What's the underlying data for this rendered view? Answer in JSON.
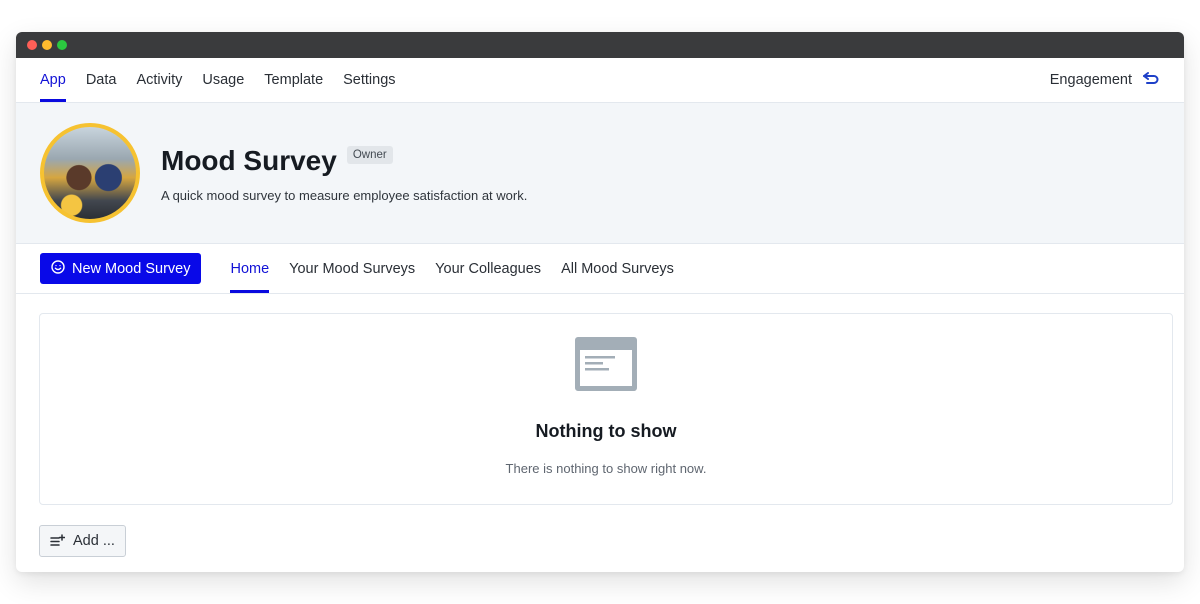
{
  "window": {
    "controls": [
      "close",
      "minimize",
      "maximize"
    ]
  },
  "topnav": {
    "tabs": [
      {
        "label": "App",
        "active": true
      },
      {
        "label": "Data",
        "active": false
      },
      {
        "label": "Activity",
        "active": false
      },
      {
        "label": "Usage",
        "active": false
      },
      {
        "label": "Template",
        "active": false
      },
      {
        "label": "Settings",
        "active": false
      }
    ],
    "right_label": "Engagement",
    "right_icon": "back-arrow-icon"
  },
  "header": {
    "title": "Mood Survey",
    "badge": "Owner",
    "description": "A quick mood survey to measure employee satisfaction at work.",
    "avatar_alt": "Two coworkers smiling at a computer in an office",
    "accent_color": "#f6c231"
  },
  "subnav": {
    "primary_button": {
      "label": "New Mood Survey",
      "icon": "smiley-icon"
    },
    "tabs": [
      {
        "label": "Home",
        "active": true
      },
      {
        "label": "Your Mood Surveys",
        "active": false
      },
      {
        "label": "Your Colleagues",
        "active": false
      },
      {
        "label": "All Mood Surveys",
        "active": false
      }
    ]
  },
  "empty_state": {
    "icon": "empty-window-icon",
    "title": "Nothing to show",
    "description": "There is nothing to show right now."
  },
  "add_button": {
    "label": "Add ...",
    "icon": "add-list-icon"
  },
  "colors": {
    "brand": "#0909e8",
    "active_tab": "#1212d6",
    "header_bg": "#f3f6f9",
    "titlebar": "#3a3b3d"
  }
}
